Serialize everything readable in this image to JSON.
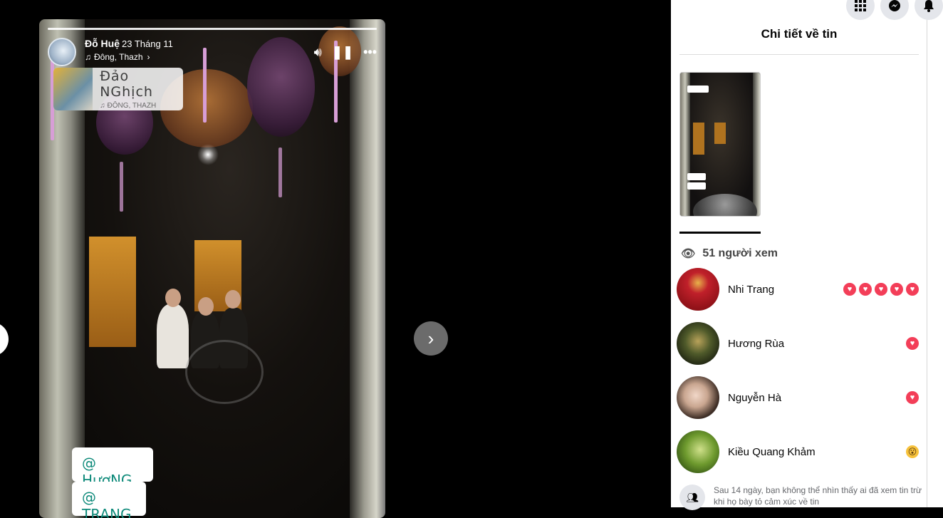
{
  "story": {
    "author": "Đỗ Huệ",
    "date": "23 Tháng 11",
    "music": "Đông, Thazh",
    "music_card": {
      "title": "Đảo NGhịch",
      "artist": "ĐÔNG, THAZH"
    },
    "tags": [
      "@ HươNG",
      "@ TRANG"
    ]
  },
  "panel": {
    "title": "Chi tiết về tin",
    "viewers_count": "51 người xem",
    "viewers": [
      {
        "name": "Nhi Trang",
        "reactions": [
          "heart",
          "heart",
          "heart",
          "heart",
          "heart"
        ]
      },
      {
        "name": "Hương Rùa",
        "reactions": [
          "heart"
        ]
      },
      {
        "name": "Nguyễn Hà",
        "reactions": [
          "heart"
        ]
      },
      {
        "name": "Kiều Quang Khảm",
        "reactions": [
          "wow"
        ]
      }
    ],
    "privacy_note": "Sau 14 ngày, bạn không thể nhìn thấy ai đã xem tin trừ khi họ bày tỏ cảm xúc về tin"
  },
  "icons": {
    "top": [
      "apps-grid-icon",
      "messenger-icon",
      "bell-icon"
    ],
    "story_controls": [
      "volume-icon",
      "pause-icon",
      "more-icon"
    ]
  },
  "colors": {
    "heart": "#f33e58",
    "wow": "#f7c23c",
    "tag_text": "#0e8a7a"
  }
}
